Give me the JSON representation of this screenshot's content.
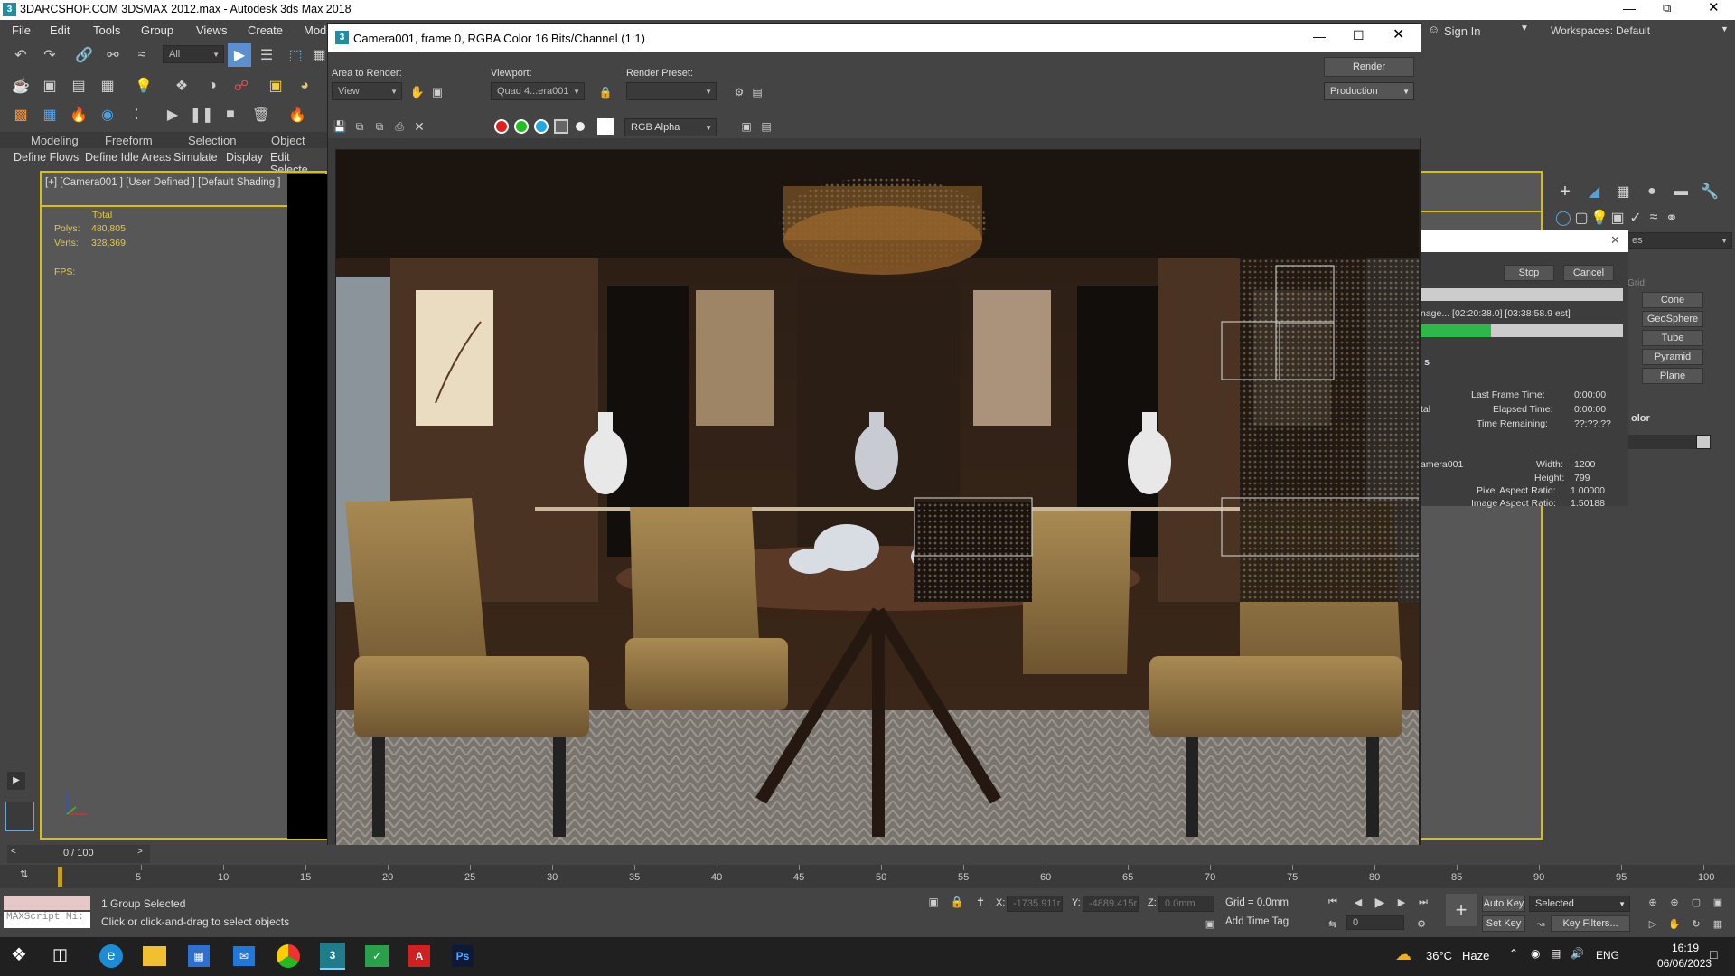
{
  "window": {
    "title": "3DARCSHOP.COM 3DSMAX 2012.max - Autodesk 3ds Max 2018"
  },
  "menu": [
    "File",
    "Edit",
    "Tools",
    "Group",
    "Views",
    "Create",
    "Mod"
  ],
  "header_right": {
    "sign_in": "Sign In",
    "workspaces_label": "Workspaces:",
    "workspaces_value": "Default"
  },
  "toolbar": {
    "selection_filter": "All"
  },
  "ribbon": {
    "tabs": [
      "Modeling",
      "Freeform",
      "Selection",
      "Object Pain"
    ],
    "subtabs": [
      "Define Flows",
      "Define Idle Areas",
      "Simulate",
      "Display",
      "Edit Selecte"
    ]
  },
  "viewport": {
    "label": "[+] [Camera001 ] [User Defined ] [Default Shading ]",
    "stats_total": "Total",
    "polys_label": "Polys:",
    "polys_value": "480,805",
    "verts_label": "Verts:",
    "verts_value": "328,369",
    "fps_label": "FPS:"
  },
  "frame_window": {
    "title": "Camera001, frame 0, RGBA Color 16 Bits/Channel (1:1)",
    "area_label": "Area to Render:",
    "area_value": "View",
    "viewport_label": "Viewport:",
    "viewport_value": "Quad 4...era001",
    "preset_label": "Render Preset:",
    "preset_value": "",
    "render_button": "Render",
    "production_value": "Production",
    "channel_value": "RGB Alpha"
  },
  "progress": {
    "stop": "Stop",
    "cancel": "Cancel",
    "image_text": "nage... [02:20:38.0] [03:38:58.9 est]",
    "progress": 0.35,
    "section": "s",
    "last_frame_label": "Last Frame Time:",
    "last_frame_value": "0:00:00",
    "elapsed_label": "Elapsed Time:",
    "elapsed_value": "0:00:00",
    "remaining_label": "Time Remaining:",
    "remaining_value": "??:??:??",
    "ctal": "tal",
    "camera": "amera001",
    "width_label": "Width:",
    "width_value": "1200",
    "height_label": "Height:",
    "height_value": "799",
    "par_label": "Pixel Aspect Ratio:",
    "par_value": "1.00000",
    "iar_label": "Image Aspect Ratio:",
    "iar_value": "1.50188"
  },
  "command_panel": {
    "grid": "Grid",
    "es": "es",
    "items": [
      "Cone",
      "GeoSphere",
      "Tube",
      "Pyramid",
      "Plane"
    ],
    "color_label": "olor"
  },
  "timeline": {
    "counter": "0 / 100",
    "ticks": [
      "5",
      "10",
      "15",
      "20",
      "25",
      "30",
      "35",
      "40",
      "45",
      "50",
      "55",
      "60",
      "65",
      "70",
      "75",
      "80",
      "85",
      "90",
      "95",
      "100"
    ]
  },
  "status": {
    "maxscript": "MAXScript Mi:",
    "selection": "1 Group Selected",
    "hint": "Click or click-and-drag to select objects",
    "x_label": "X:",
    "x_value": "-1735.911r",
    "y_label": "Y:",
    "y_value": "-4889.415r",
    "z_label": "Z:",
    "z_value": "0.0mm",
    "grid": "Grid = 0.0mm",
    "add_time_tag": "Add Time Tag",
    "auto_key": "Auto Key",
    "selected": "Selected",
    "set_key": "Set Key",
    "key_filters": "Key Filters...",
    "frame_field": "0"
  },
  "taskbar": {
    "weather_temp": "36°C",
    "weather": "Haze",
    "lang": "ENG",
    "time": "16:19",
    "date": "06/06/2023"
  }
}
